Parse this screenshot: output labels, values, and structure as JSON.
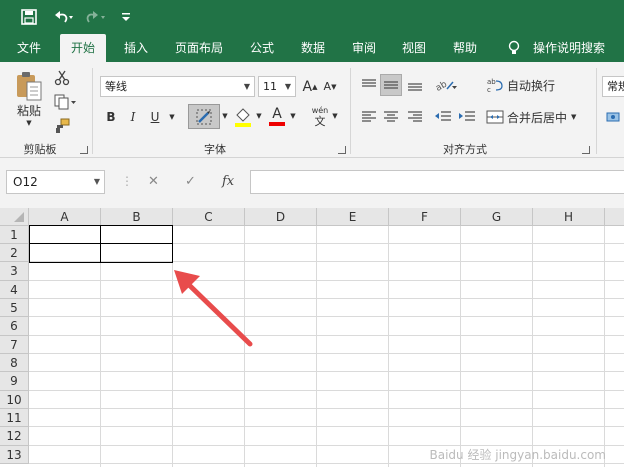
{
  "colors": {
    "brand": "#217346",
    "ribbon_bg": "#f3f3f3",
    "arrow": "#e84c4c"
  },
  "qat": {
    "save_icon": "save-icon",
    "undo_icon": "undo-icon",
    "redo_icon": "redo-icon",
    "customize_icon": "customize-qat-icon"
  },
  "tabs": [
    {
      "label": "文件"
    },
    {
      "label": "开始"
    },
    {
      "label": "插入"
    },
    {
      "label": "页面布局"
    },
    {
      "label": "公式"
    },
    {
      "label": "数据"
    },
    {
      "label": "审阅"
    },
    {
      "label": "视图"
    },
    {
      "label": "帮助"
    },
    {
      "label": "操作说明搜索"
    }
  ],
  "ribbon": {
    "clipboard": {
      "paste_label": "粘贴",
      "group_label": "剪贴板"
    },
    "font": {
      "font_name": "等线",
      "font_size": "11",
      "bold": "B",
      "italic": "I",
      "underline": "U",
      "font_color_glyph": "A",
      "phonetic_glyph_top": "wén",
      "phonetic_glyph_bottom": "文",
      "grow_glyph": "A",
      "shrink_glyph": "A",
      "group_label": "字体"
    },
    "alignment": {
      "wrap_label": "自动换行",
      "merge_label": "合并后居中",
      "group_label": "对齐方式"
    },
    "number": {
      "format_label": "常规"
    }
  },
  "formula_bar": {
    "name_box": "O12",
    "cancel": "✕",
    "enter": "✓",
    "fx": "fx",
    "value": ""
  },
  "sheet": {
    "columns": [
      "A",
      "B",
      "C",
      "D",
      "E",
      "F",
      "G",
      "H"
    ],
    "rows": [
      "1",
      "2",
      "3",
      "4",
      "5",
      "6",
      "7",
      "8",
      "9",
      "10",
      "11",
      "12",
      "13"
    ]
  },
  "watermark": "Baidu 经验 jingyan.baidu.com"
}
